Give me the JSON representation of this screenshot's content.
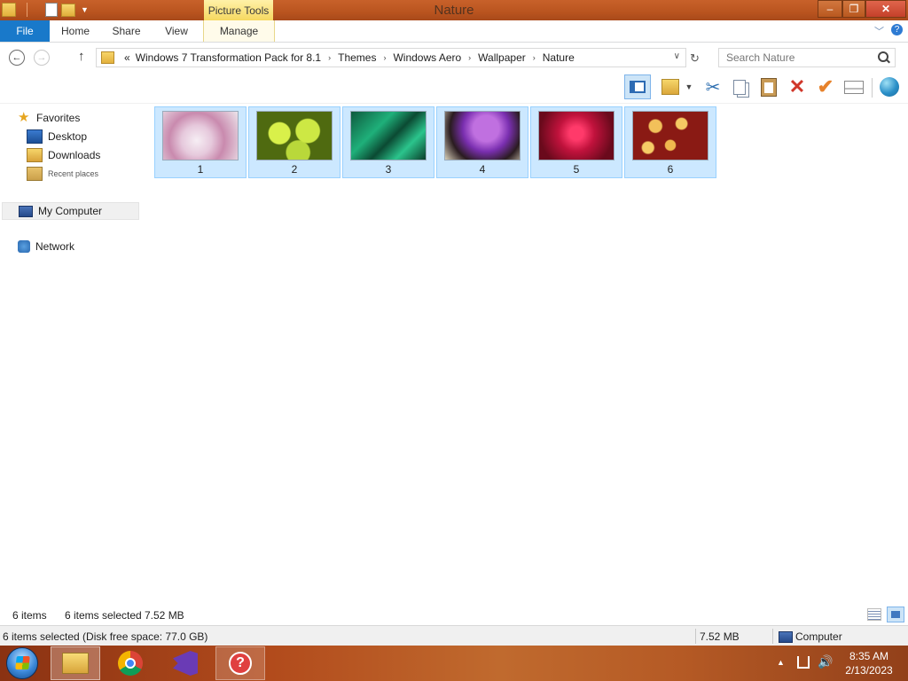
{
  "window": {
    "title": "Nature",
    "context_tab_group": "Picture Tools",
    "controls": {
      "minimize": "–",
      "maximize": "❐",
      "close": "✕"
    }
  },
  "ribbon": {
    "tabs": [
      {
        "label": "File"
      },
      {
        "label": "Home"
      },
      {
        "label": "Share"
      },
      {
        "label": "View"
      },
      {
        "label": "Manage"
      }
    ],
    "help": "?"
  },
  "address": {
    "overflow": "«",
    "crumbs": [
      "Windows 7 Transformation Pack for 8.1",
      "Themes",
      "Windows Aero",
      "Wallpaper",
      "Nature"
    ],
    "separator": "›"
  },
  "search": {
    "placeholder": "Search Nature"
  },
  "navpane": {
    "favorites": "Favorites",
    "desktop": "Desktop",
    "downloads": "Downloads",
    "recent_places": "Recent places",
    "my_computer": "My Computer",
    "network": "Network"
  },
  "files": [
    {
      "name": "1",
      "selected": true
    },
    {
      "name": "2",
      "selected": true
    },
    {
      "name": "3",
      "selected": true
    },
    {
      "name": "4",
      "selected": true
    },
    {
      "name": "5",
      "selected": true
    },
    {
      "name": "6",
      "selected": true
    }
  ],
  "status": {
    "count": "6 items",
    "selected": "6 items selected",
    "size": "7.52 MB",
    "disk": "6 items selected (Disk free space: 77.0 GB)",
    "size2": "7.52 MB",
    "location": "Computer"
  },
  "taskbar": {
    "apps": [
      "file-explorer",
      "chrome",
      "visual-studio",
      "help-and-support"
    ],
    "clock_time": "8:35 AM",
    "clock_date": "2/13/2023"
  },
  "colors": {
    "accent": "#1979ca",
    "selection_fill": "#cce8ff",
    "selection_border": "#99d1ff",
    "titlebar": "#b9541f",
    "picture_tools": "#f6d860"
  }
}
